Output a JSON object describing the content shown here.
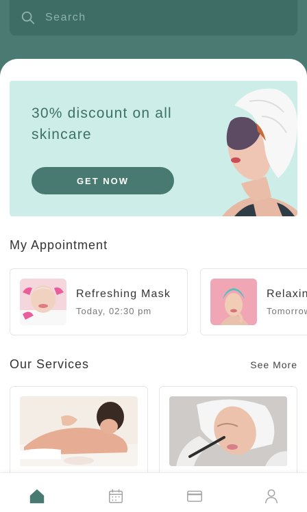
{
  "search": {
    "placeholder": "Search",
    "icon": "search-icon"
  },
  "promo": {
    "title": "30% discount on all skincare",
    "button_label": "GET NOW"
  },
  "appointments": {
    "section_title": "My Appointment",
    "items": [
      {
        "title": "Refreshing Mask",
        "time": "Today, 02:30 pm"
      },
      {
        "title": "Relaxing",
        "time": "Tomorrow"
      }
    ]
  },
  "services": {
    "section_title": "Our Services",
    "see_more_label": "See More"
  },
  "bottom_nav": {
    "items": [
      {
        "icon": "home-icon",
        "active": true
      },
      {
        "icon": "calendar-icon",
        "active": false
      },
      {
        "icon": "card-icon",
        "active": false
      },
      {
        "icon": "profile-icon",
        "active": false
      }
    ]
  },
  "colors": {
    "primary": "#487a71",
    "header": "#4a7a72",
    "promo_bg": "#cdeee8",
    "text_dark": "#333333",
    "text_muted": "#777777"
  }
}
